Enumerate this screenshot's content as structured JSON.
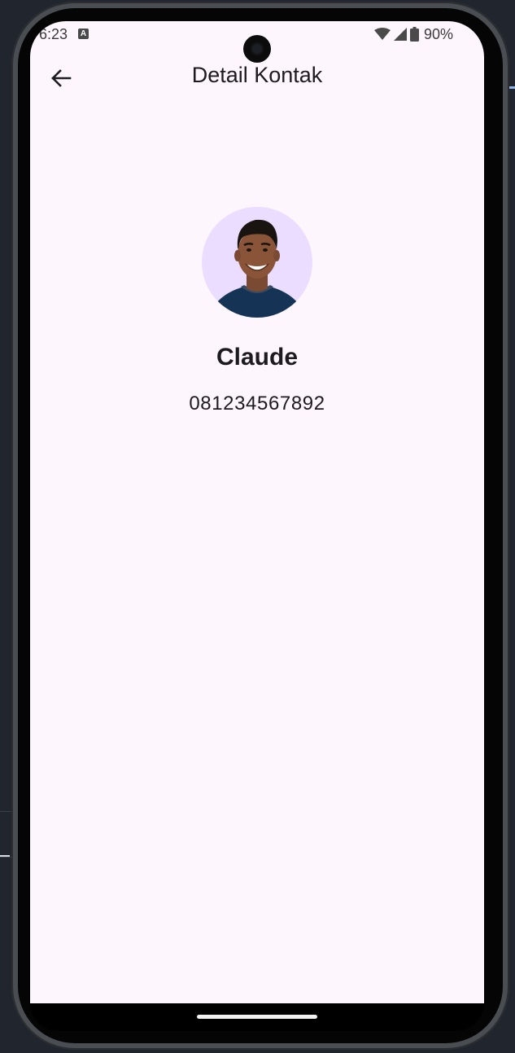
{
  "status_bar": {
    "time": "6:23",
    "notification_icon": "a-icon",
    "battery": "90%"
  },
  "app_bar": {
    "title": "Detail Kontak",
    "back_icon": "arrow-left-icon"
  },
  "contact": {
    "avatar": "avatar-photo",
    "name": "Claude",
    "phone": "081234567892"
  },
  "colors": {
    "screen_background": "#fdf6fd",
    "avatar_background": "#eaddff",
    "text_primary": "#1d1b20"
  }
}
